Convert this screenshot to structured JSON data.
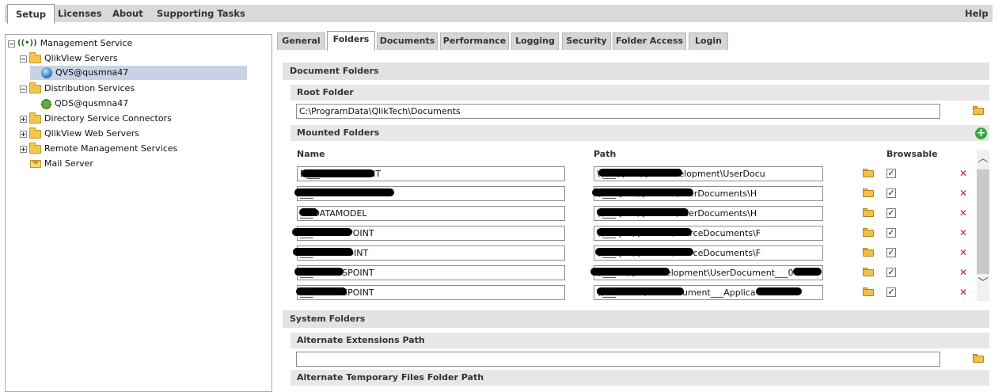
{
  "menu": {
    "items": [
      "Setup",
      "Licenses",
      "About",
      "Supporting Tasks"
    ],
    "help": "Help"
  },
  "tree": {
    "management_service": "Management Service",
    "qlikview_servers": "QlikView Servers",
    "qvs_node": "QVS@qusmna47",
    "distribution_services": "Distribution Services",
    "qds_node": "QDS@qusmna47",
    "directory_service_connectors": "Directory Service Connectors",
    "qlikview_web_servers": "QlikView Web Servers",
    "remote_management_services": "Remote Management Services",
    "mail_server": "Mail Server"
  },
  "tabs": [
    "General",
    "Folders",
    "Documents",
    "Performance",
    "Logging",
    "Security",
    "Folder Access",
    "Login"
  ],
  "document_folders": {
    "title": "Document Folders",
    "root_folder_label": "Root Folder",
    "root_folder_value": "C:\\ProgramData\\QlikTech\\Documents",
    "mounted_folders_label": "Mounted Folders",
    "columns": {
      "name": "Name",
      "path": "Path",
      "browsable": "Browsable"
    },
    "rows": [
      {
        "name": "D___ACCESSPOINT",
        "path": "\\\\___\\QLIK\\Qlik-Development\\UserDocu",
        "browsable": true
      },
      {
        "name": "___ACCESSPOINT",
        "path": "\\\\___QLIK\\Qlik-Test\\UserDocuments\\H",
        "browsable": true
      },
      {
        "name": "___DATAMODEL",
        "path": "\\\\___QLIK\\Qlik-Test\\UserDocuments\\H",
        "browsable": true
      },
      {
        "name": "___ACCESSPOINT",
        "path": "\\\\___qlik\\Qlik-Test\\SourceDocuments\\F",
        "browsable": true
      },
      {
        "name": "___CCESSPOINT",
        "path": "\\\\___qlik\\Qlik-Test\\SourceDocuments\\F",
        "browsable": true
      },
      {
        "name": "___ACCESSPOINT",
        "path": "\\\\___lik\\Qlik-Development\\UserDocument___0",
        "browsable": true
      },
      {
        "name": "___ACCESSPOINT",
        "path": "\\\\___ik-Test\\UserDocument___Applica",
        "browsable": true
      }
    ]
  },
  "system_folders": {
    "title": "System Folders",
    "alt_extensions_label": "Alternate Extensions Path",
    "alt_extensions_value": "",
    "alt_temp_label": "Alternate Temporary Files Folder Path"
  },
  "colors": {
    "menubar": "#d9d9d9",
    "selected_tree": "#c8d3e6",
    "delete": "#d02020",
    "add": "#3aa53a"
  }
}
